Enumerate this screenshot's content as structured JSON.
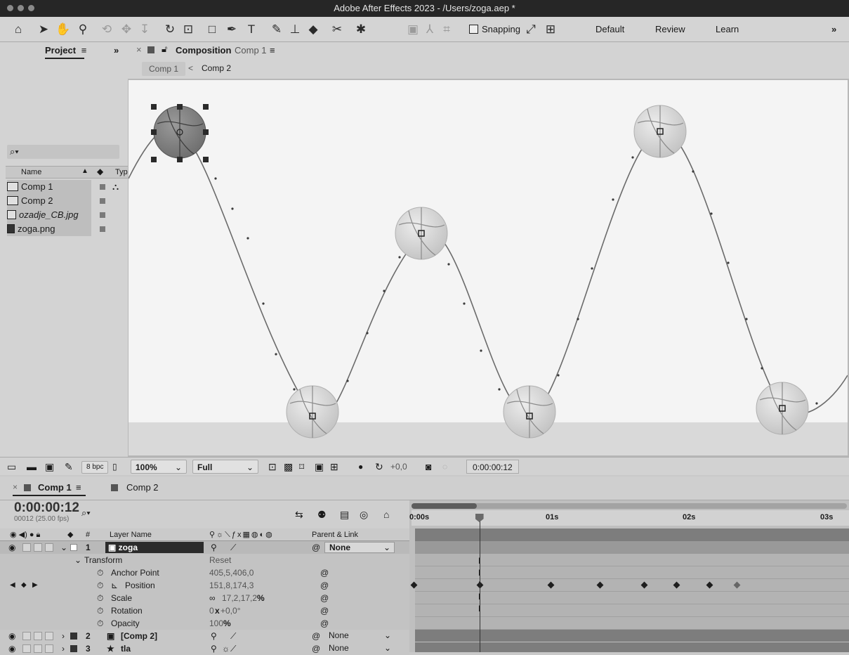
{
  "window": {
    "title": "Adobe After Effects 2023 - /Users/zoga.aep *"
  },
  "toolbar": {
    "snapping_label": "Snapping",
    "workspaces": [
      "Default",
      "Review",
      "Learn"
    ],
    "overflow": "»"
  },
  "project_panel": {
    "tab_label": "Project",
    "menu_icon": "≡",
    "expand": "»",
    "search_placeholder": "⌕▾",
    "columns": {
      "name": "Name",
      "type": "Typ"
    },
    "items": [
      {
        "name": "Comp 1",
        "icon": "composition-icon"
      },
      {
        "name": "Comp 2",
        "icon": "composition-icon"
      },
      {
        "name": "ozadje_CB.jpg",
        "icon": "image-file-icon"
      },
      {
        "name": "zoga.png",
        "icon": "png-file-icon"
      }
    ],
    "bpc_label": "8 bpc"
  },
  "composition_panel": {
    "close": "×",
    "tab_prefix": "Composition",
    "tab_name": "Comp 1",
    "menu_icon": "≡",
    "breadcrumbs": [
      "Comp 1",
      "Comp 2"
    ],
    "breadcrumb_sep": "<"
  },
  "viewer_controls": {
    "zoom": "100%",
    "resolution": "Full",
    "exposure": "+0,0",
    "timecode": "0:00:00:12"
  },
  "timeline": {
    "tabs": [
      {
        "label": "Comp 1",
        "active": true
      },
      {
        "label": "Comp 2",
        "active": false
      }
    ],
    "timecode": "0:00:00:12",
    "frame_info": "00012 (25.00 fps)",
    "search_icon": "⌕▾",
    "headers": {
      "num": "#",
      "layer_name": "Layer Name",
      "parent": "Parent & Link"
    },
    "ruler": [
      "0:00s",
      "01s",
      "02s",
      "03s"
    ],
    "layers": [
      {
        "num": "1",
        "name": "zoga",
        "parent": "None",
        "selected": true,
        "expanded": true
      },
      {
        "num": "2",
        "name": "[Comp 2]",
        "parent": "None",
        "selected": false,
        "expanded": false
      },
      {
        "num": "3",
        "name": "tla",
        "parent": "None",
        "selected": false,
        "expanded": false
      }
    ],
    "transform": {
      "label": "Transform",
      "reset": "Reset",
      "properties": [
        {
          "name": "Anchor Point",
          "value": "405,5,406,0"
        },
        {
          "name": "Position",
          "value": "151,8,174,3"
        },
        {
          "name": "Scale",
          "value": "17,2,17,2",
          "unit": "%",
          "link": "∞"
        },
        {
          "name": "Rotation",
          "value": "0",
          "value_x": "x",
          "value_rest": "+0,0°"
        },
        {
          "name": "Opacity",
          "value": "100",
          "unit": "%"
        }
      ]
    },
    "work_area_end": 0.15,
    "playhead_seconds": 0.48,
    "position_keyframes_seconds": [
      0.0,
      0.48,
      1.0,
      1.36,
      1.68,
      1.92,
      2.16,
      2.36
    ]
  },
  "colors": {
    "title_bar": "#262626",
    "panel": "#d3d3d3",
    "canvas": "#f4f4f4",
    "floor": "#d9d9d9",
    "track": "#b3b3b3",
    "layer_bar": "#7d7d7d"
  }
}
